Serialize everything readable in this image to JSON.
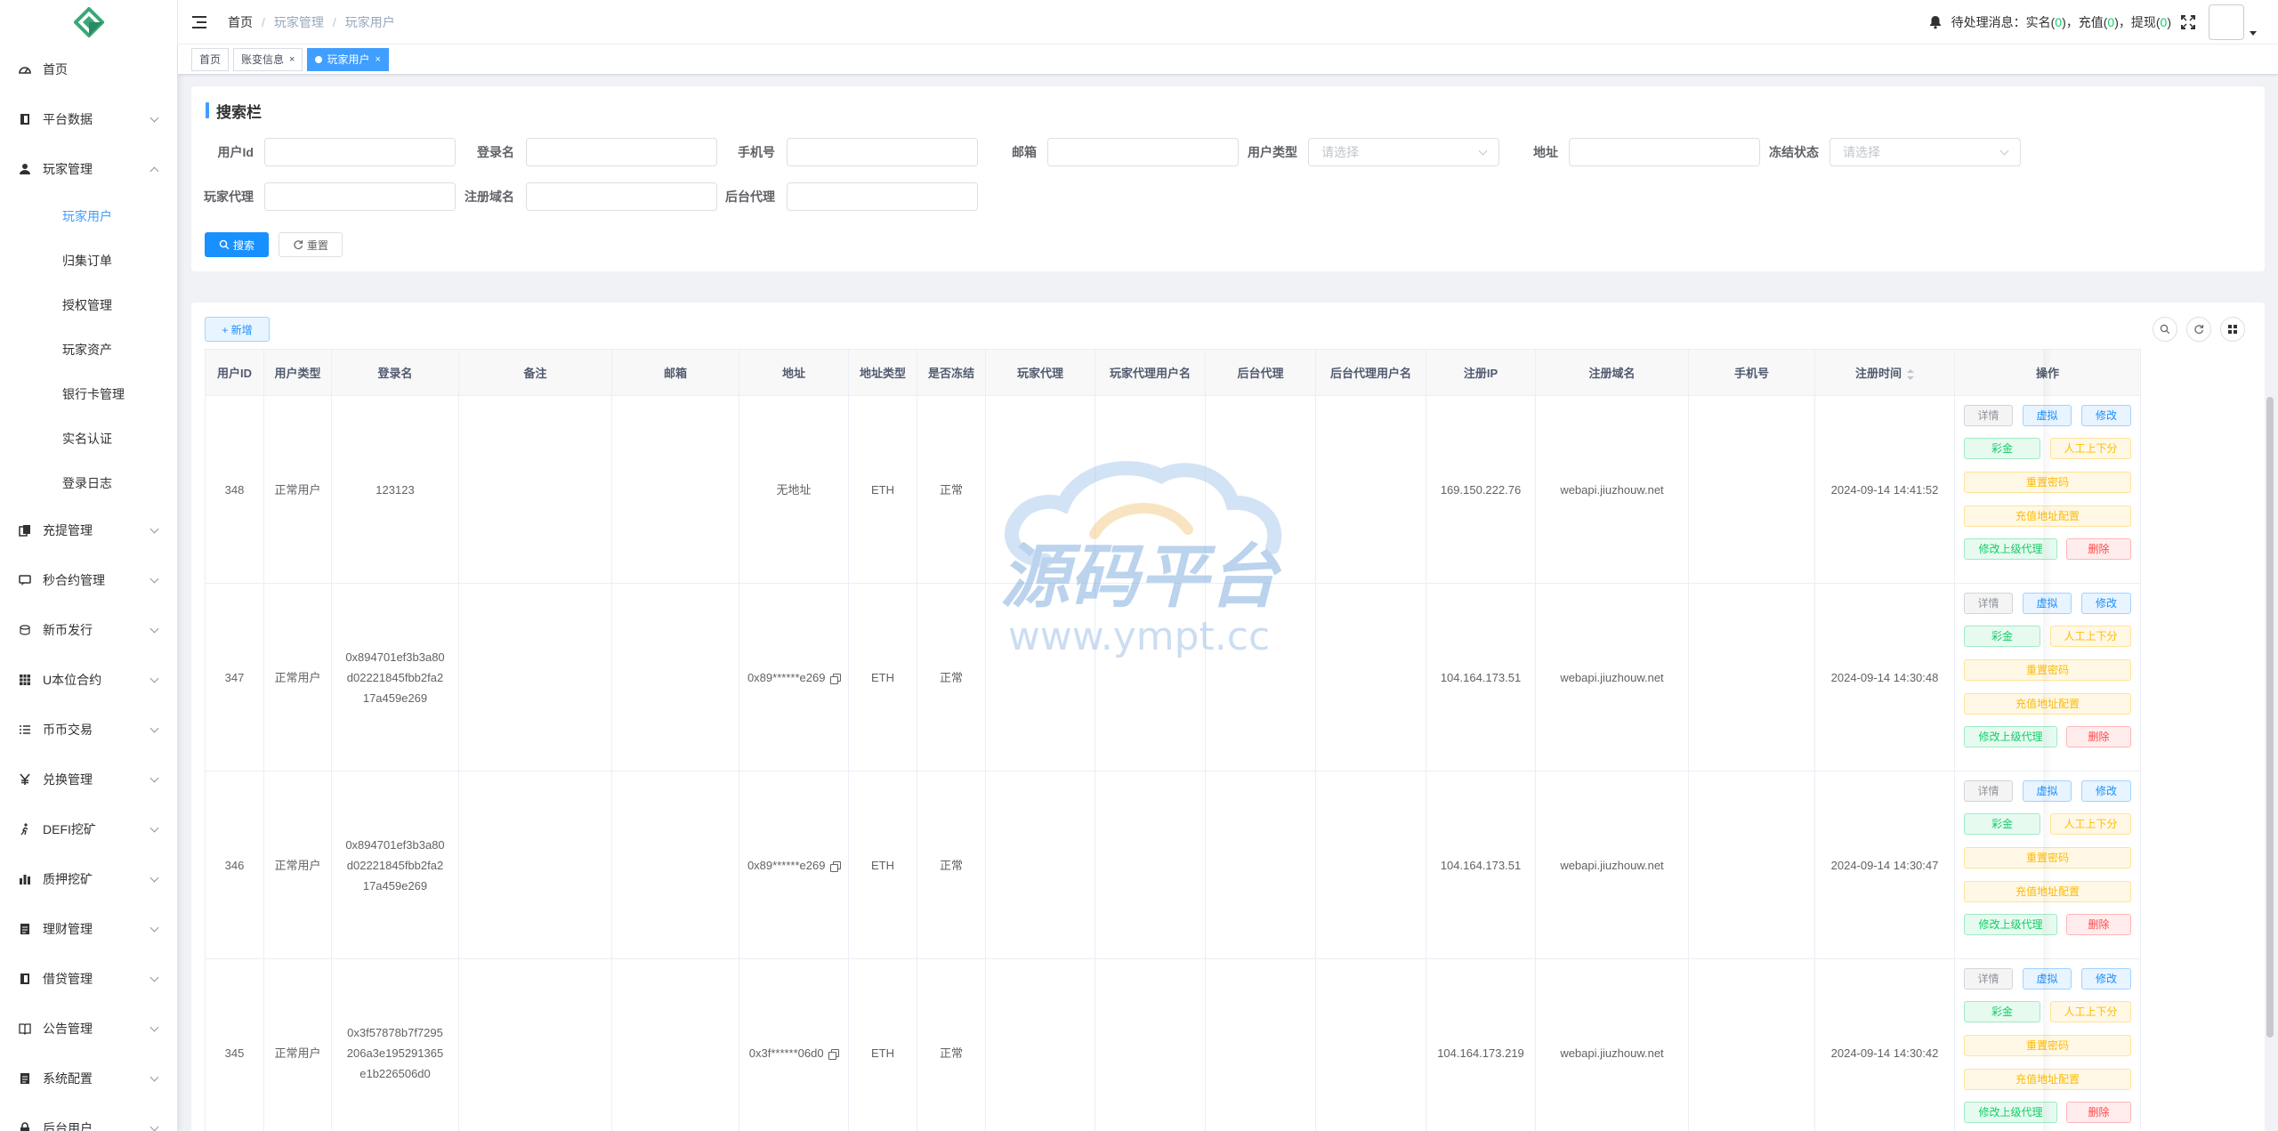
{
  "sidebar": {
    "items": [
      {
        "label": "首页",
        "icon": "dashboard-icon",
        "arrow": false
      },
      {
        "label": "平台数据",
        "icon": "book-icon",
        "arrow": true
      },
      {
        "label": "玩家管理",
        "icon": "user-icon",
        "arrow": true,
        "open": true
      },
      {
        "label": "充提管理",
        "icon": "copy-icon",
        "arrow": true
      },
      {
        "label": "秒合约管理",
        "icon": "message-icon",
        "arrow": true
      },
      {
        "label": "新币发行",
        "icon": "coins-icon",
        "arrow": true
      },
      {
        "label": "U本位合约",
        "icon": "grid-icon",
        "arrow": true
      },
      {
        "label": "币币交易",
        "icon": "list-icon",
        "arrow": true
      },
      {
        "label": "兑换管理",
        "icon": "yen-icon",
        "arrow": true
      },
      {
        "label": "DEFI挖矿",
        "icon": "walker-icon",
        "arrow": true
      },
      {
        "label": "质押挖矿",
        "icon": "bar-chart-icon",
        "arrow": true
      },
      {
        "label": "理财管理",
        "icon": "doc-icon",
        "arrow": true
      },
      {
        "label": "借贷管理",
        "icon": "book-icon",
        "arrow": true
      },
      {
        "label": "公告管理",
        "icon": "open-book-icon",
        "arrow": true
      },
      {
        "label": "系统配置",
        "icon": "doc-icon",
        "arrow": true
      },
      {
        "label": "后台用户",
        "icon": "lock-icon",
        "arrow": true
      }
    ],
    "submenu": [
      "玩家用户",
      "归集订单",
      "授权管理",
      "玩家资产",
      "银行卡管理",
      "实名认证",
      "登录日志"
    ]
  },
  "header": {
    "breadcrumb": [
      "首页",
      "玩家管理",
      "玩家用户"
    ],
    "notice_prefix": "待处理消息：实名(",
    "realname_count": "0",
    "mid1": ")，充值(",
    "recharge_count": "0",
    "mid2": ")，提现(",
    "withdraw_count": "0",
    "suffix": ")"
  },
  "tags": [
    {
      "label": "首页",
      "active": false
    },
    {
      "label": "账变信息",
      "active": false,
      "close": "×"
    },
    {
      "label": "玩家用户",
      "active": true,
      "close": "×"
    }
  ],
  "search": {
    "title": "搜索栏",
    "fields": {
      "user_id": "用户Id",
      "login_name": "登录名",
      "phone": "手机号",
      "email": "邮箱",
      "user_type": "用户类型",
      "address": "地址",
      "frozen_status": "冻结状态",
      "player_agent": "玩家代理",
      "reg_domain": "注册域名",
      "backend_agent": "后台代理"
    },
    "select_placeholder": "请选择",
    "search_btn": "搜索",
    "reset_btn": "重置"
  },
  "toolbar": {
    "add_btn": "+ 新增"
  },
  "table": {
    "columns": [
      "用户ID",
      "用户类型",
      "登录名",
      "备注",
      "邮箱",
      "地址",
      "地址类型",
      "是否冻结",
      "玩家代理",
      "玩家代理用户名",
      "后台代理",
      "后台代理用户名",
      "注册IP",
      "注册域名",
      "手机号",
      "注册时间",
      "操作"
    ],
    "rows": [
      {
        "id": "348",
        "type": "正常用户",
        "login": "123123",
        "remark": "",
        "email": "",
        "address": "无地址",
        "copy": false,
        "addr_type": "ETH",
        "frozen": "正常",
        "agent": "",
        "agent_name": "",
        "bk_agent": "",
        "bk_agent_name": "",
        "ip": "169.150.222.76",
        "domain": "webapi.jiuzhouw.net",
        "phone": "",
        "time": "2024-09-14 14:41:52"
      },
      {
        "id": "347",
        "type": "正常用户",
        "login": "0x894701ef3b3a80d02221845fbb2fa217a459e269",
        "remark": "",
        "email": "",
        "address": "0x89******e269",
        "copy": true,
        "addr_type": "ETH",
        "frozen": "正常",
        "agent": "",
        "agent_name": "",
        "bk_agent": "",
        "bk_agent_name": "",
        "ip": "104.164.173.51",
        "domain": "webapi.jiuzhouw.net",
        "phone": "",
        "time": "2024-09-14 14:30:48"
      },
      {
        "id": "346",
        "type": "正常用户",
        "login": "0x894701ef3b3a80d02221845fbb2fa217a459e269",
        "remark": "",
        "email": "",
        "address": "0x89******e269",
        "copy": true,
        "addr_type": "ETH",
        "frozen": "正常",
        "agent": "",
        "agent_name": "",
        "bk_agent": "",
        "bk_agent_name": "",
        "ip": "104.164.173.51",
        "domain": "webapi.jiuzhouw.net",
        "phone": "",
        "time": "2024-09-14 14:30:47"
      },
      {
        "id": "345",
        "type": "正常用户",
        "login": "0x3f57878b7f7295206a3e195291365e1b226506d0",
        "remark": "",
        "email": "",
        "address": "0x3f******06d0",
        "copy": true,
        "addr_type": "ETH",
        "frozen": "正常",
        "agent": "",
        "agent_name": "",
        "bk_agent": "",
        "bk_agent_name": "",
        "ip": "104.164.173.219",
        "domain": "webapi.jiuzhouw.net",
        "phone": "",
        "time": "2024-09-14 14:30:42"
      }
    ],
    "actions": {
      "detail": "详情",
      "mock": "虚拟",
      "edit": "修改",
      "bonus": "彩金",
      "manual": "人工上下分",
      "reset_pwd": "重置密码",
      "recharge_addr": "充值地址配置",
      "change_parent": "修改上级代理",
      "delete": "删除"
    }
  },
  "watermark": {
    "line1": "源码平台",
    "line2": "www.ympt.cc"
  },
  "colors": {
    "primary": "#1890ff",
    "success": "#13ce66",
    "warning": "#ffba00",
    "danger": "#ff4949"
  }
}
